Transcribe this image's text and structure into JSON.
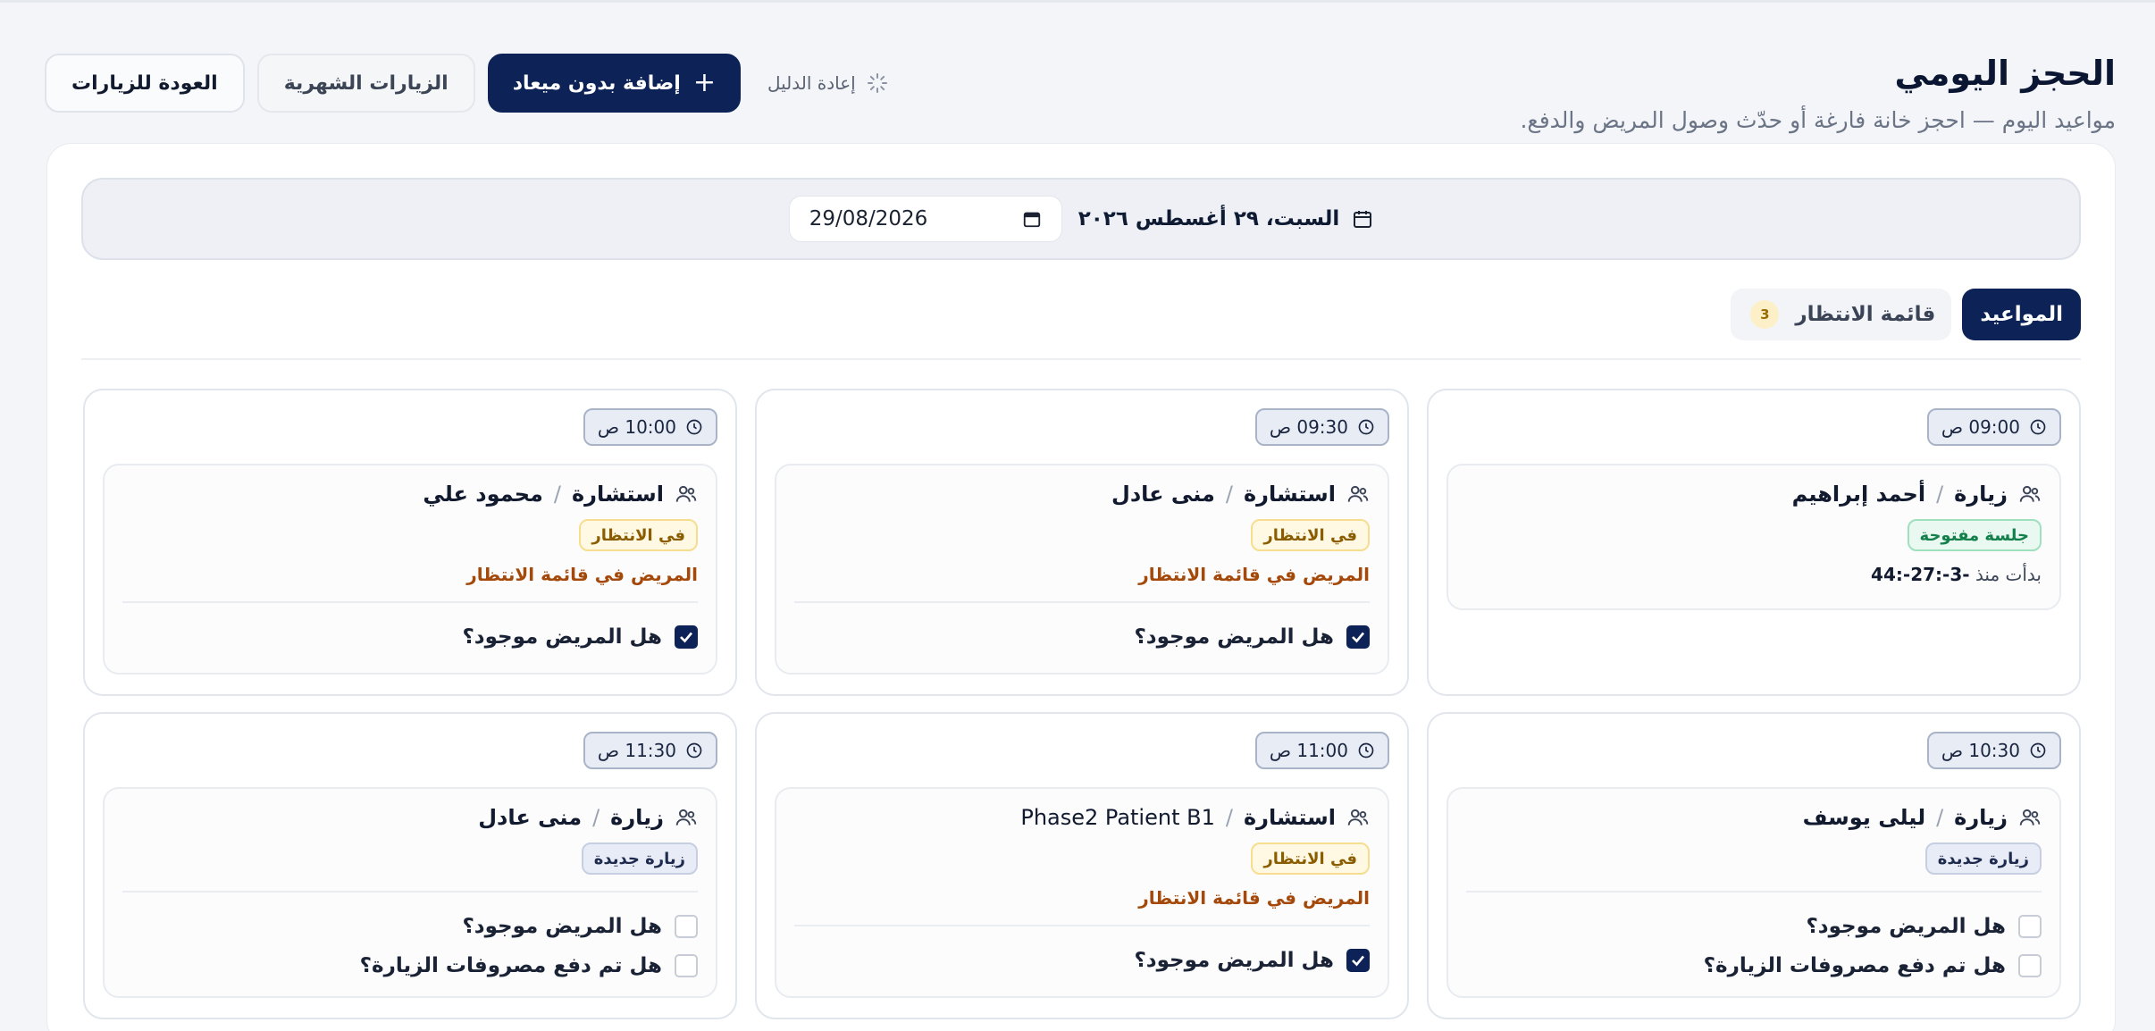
{
  "header": {
    "title": "الحجز اليومي",
    "subtitle": "مواعيد اليوم — احجز خانة فارغة أو حدّث وصول المريض والدفع.",
    "back_label": "العودة للزيارات",
    "monthly_label": "الزيارات الشهرية",
    "add_label": "إضافة بدون ميعاد",
    "reset_label": "إعادة الدليل"
  },
  "date_bar": {
    "label": "السبت، ٢٩ أغسطس ٢٠٢٦",
    "input_value": "29/08/2026"
  },
  "tabs": {
    "appointments": "المواعيد",
    "waiting": "قائمة الانتظار",
    "waiting_count": "3"
  },
  "slots": [
    {
      "time": "09:00 ص",
      "type": "زيارة",
      "name": "أحمد إبراهيم",
      "status": "جلسة مفتوحة",
      "since_label": "بدأت منذ",
      "since_value": "-3-:27-:44"
    },
    {
      "time": "09:30 ص",
      "type": "استشارة",
      "name": "منى عادل",
      "status": "في الانتظار",
      "note": "المريض في قائمة الانتظار",
      "q_present": "هل المريض موجود؟"
    },
    {
      "time": "10:00 ص",
      "type": "استشارة",
      "name": "محمود علي",
      "status": "في الانتظار",
      "note": "المريض في قائمة الانتظار",
      "q_present": "هل المريض موجود؟"
    },
    {
      "time": "10:30 ص",
      "type": "زيارة",
      "name": "ليلى يوسف",
      "status": "زيارة جديدة",
      "q_present": "هل المريض موجود؟",
      "q_paid": "هل تم دفع مصروفات الزيارة؟"
    },
    {
      "time": "11:00 ص",
      "type": "استشارة",
      "name": "Phase2 Patient B1",
      "status": "في الانتظار",
      "note": "المريض في قائمة الانتظار",
      "q_present": "هل المريض موجود؟"
    },
    {
      "time": "11:30 ص",
      "type": "زيارة",
      "name": "منى عادل",
      "status": "زيارة جديدة",
      "q_present": "هل المريض موجود؟",
      "q_paid": "هل تم دفع مصروفات الزيارة؟"
    }
  ]
}
